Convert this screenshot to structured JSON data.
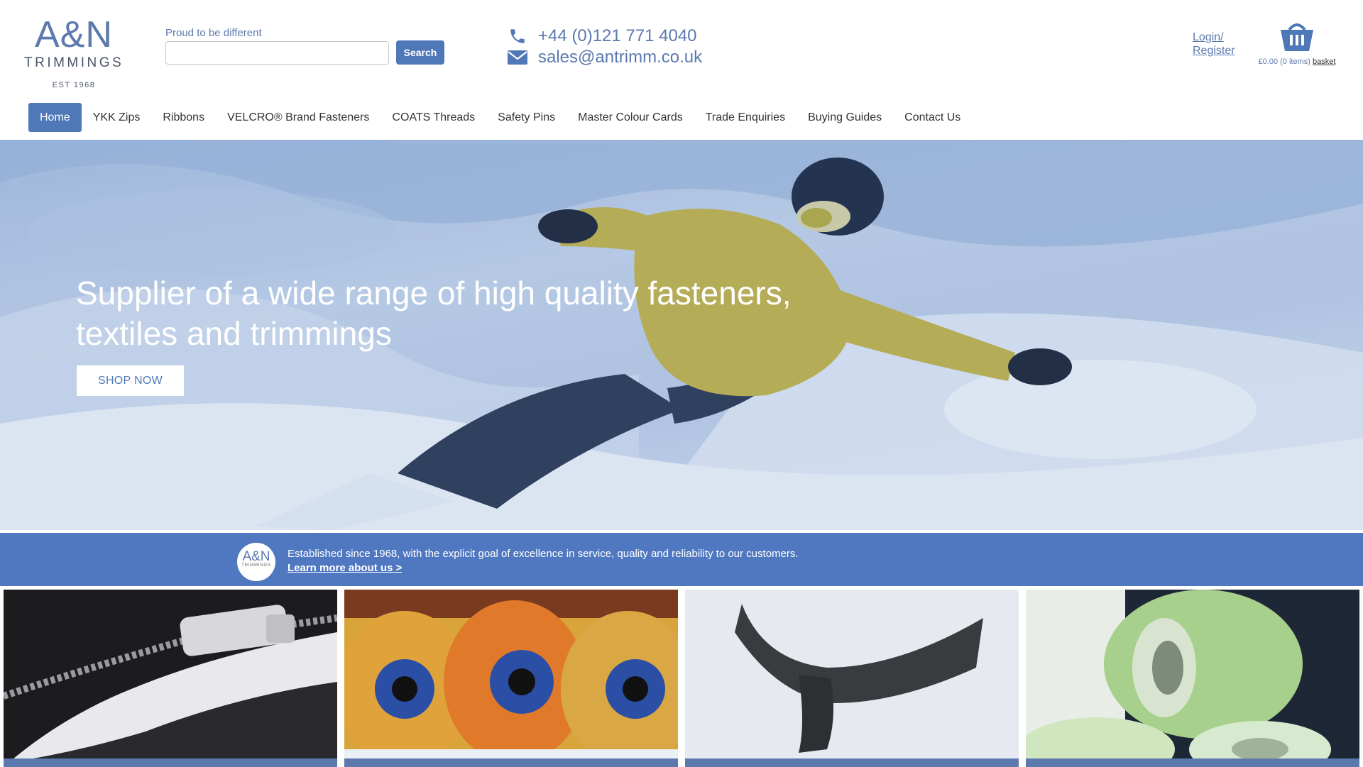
{
  "logo": {
    "main": "A&N",
    "sub": "TRIMMINGS",
    "est": "EST 1968"
  },
  "search": {
    "caption": "Proud to be different",
    "placeholder": "",
    "value": "",
    "button": "Search"
  },
  "contact": {
    "phone": "+44 (0)121 771 4040",
    "email": "sales@antrimm.co.uk"
  },
  "account": {
    "login_line1": "Login/",
    "login_line2": "Register"
  },
  "basket": {
    "total": "£0.00 (0 items)",
    "link": "basket"
  },
  "nav": {
    "items": [
      {
        "label": "Home",
        "active": true
      },
      {
        "label": "YKK Zips"
      },
      {
        "label": "Ribbons"
      },
      {
        "label": "VELCRO® Brand Fasteners"
      },
      {
        "label": "COATS Threads"
      },
      {
        "label": "Safety Pins"
      },
      {
        "label": "Master Colour Cards"
      },
      {
        "label": "Trade Enquiries"
      },
      {
        "label": "Buying Guides"
      },
      {
        "label": "Contact Us"
      }
    ]
  },
  "hero": {
    "title": "Supplier of a wide range of high quality fasteners, textiles and trimmings",
    "button": "SHOP NOW"
  },
  "info": {
    "logo_main": "A&N",
    "logo_sub": "TRIMMINGS",
    "text": "Established since 1968, with the explicit goal of excellence in service, quality and reliability to our customers.",
    "link": "Learn more about us >"
  },
  "tiles": [
    {
      "name": "zip-tile"
    },
    {
      "name": "thread-tile"
    },
    {
      "name": "velcro-tile"
    },
    {
      "name": "ribbon-tile"
    }
  ],
  "colors": {
    "brand_blue": "#4f78b8",
    "info_bar": "#4f78c0",
    "text_blue": "#5b79ad"
  }
}
